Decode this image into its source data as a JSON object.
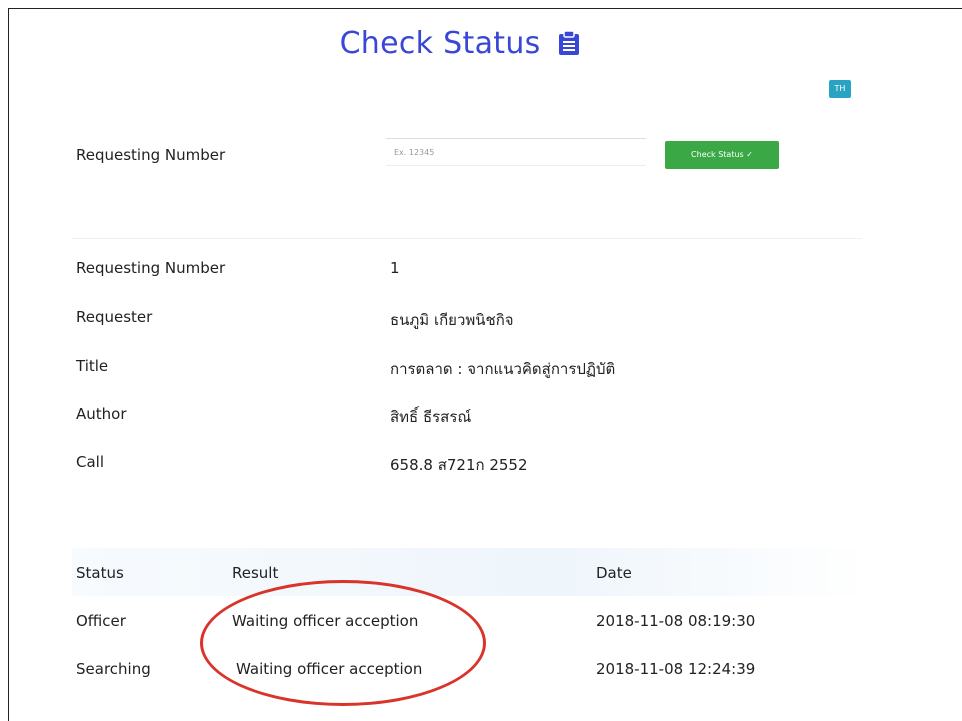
{
  "header": {
    "title": "Check Status",
    "lang_button": "TH"
  },
  "search": {
    "label": "Requesting Number",
    "placeholder": "Ex. 12345",
    "button_label": "Check Status"
  },
  "details": [
    {
      "label": "Requesting Number",
      "value": "1"
    },
    {
      "label": "Requester",
      "value": "ธนภูมิ เกียวพนิชกิจ"
    },
    {
      "label": "Title",
      "value": "การตลาด : จากแนวคิดสู่การปฏิบัติ"
    },
    {
      "label": "Author",
      "value": "สิทธิ์ ธีรสรณ์"
    },
    {
      "label": "Call",
      "value": "658.8 ส721ก 2552"
    }
  ],
  "status_table": {
    "headers": [
      "Status",
      "Result",
      "Date"
    ],
    "rows": [
      [
        "Officer",
        "Waiting officer acception",
        "2018-11-08 08:19:30"
      ],
      [
        "Searching",
        "Waiting officer acception",
        "2018-11-08 12:24:39"
      ]
    ]
  },
  "colors": {
    "title": "#3847d6",
    "check_button": "#3aa845",
    "lang_button": "#2aa3c2",
    "highlight": "#d9332a"
  },
  "icons": {
    "title_icon": "clipboard-list-icon",
    "check_button_icon": "check-icon"
  }
}
